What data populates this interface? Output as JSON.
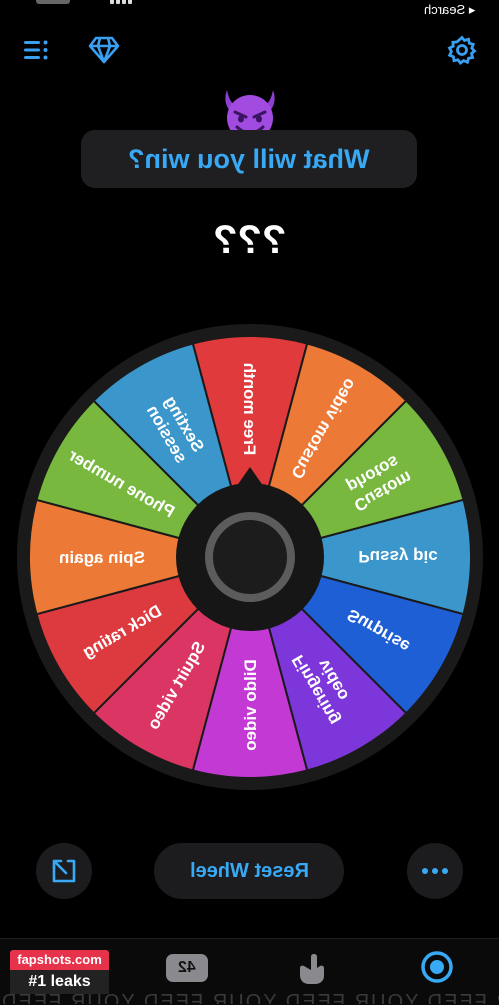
{
  "status": {
    "back_label": "Search"
  },
  "header": {
    "menu_icon": "list-icon",
    "premium_icon": "diamond-icon",
    "settings_icon": "gear-icon"
  },
  "title": {
    "emoji": "smiling-devil-emoji",
    "text": "What will you win?"
  },
  "result": {
    "text": "???"
  },
  "wheel": {
    "segments": [
      {
        "label": "Free month",
        "color": "#e03a3c"
      },
      {
        "label": "Custom video",
        "color": "#ec7a36"
      },
      {
        "label": "Custom photos",
        "color": "#78b83f"
      },
      {
        "label": "Pussy pic",
        "color": "#3b96cb"
      },
      {
        "label": "Surprise",
        "color": "#1f5fd6"
      },
      {
        "label": "Fingering video",
        "color": "#7d36d9"
      },
      {
        "label": "Dildo video",
        "color": "#c23ad3"
      },
      {
        "label": "Squirt video",
        "color": "#db3663"
      },
      {
        "label": "Dick rating",
        "color": "#dd3a3f"
      },
      {
        "label": "Spin again",
        "color": "#ec7a36"
      },
      {
        "label": "Phone number",
        "color": "#78b83f"
      },
      {
        "label": "Sexting session",
        "color": "#3b96cb"
      }
    ],
    "accent": "#38a9f5"
  },
  "controls": {
    "reset_label": "Reset Wheel",
    "share_icon": "share-icon",
    "more_icon": "more-icon"
  },
  "tabbar": {
    "watermark_top": "fapshots.com",
    "watermark_bottom": "#1 leaks",
    "badge_value": "42",
    "hand_icon": "hand-icon",
    "wheel_icon": "target-icon",
    "bottom_text": "YOUR FEED YOUR FEED YOUR FEED YOUR FEED"
  }
}
